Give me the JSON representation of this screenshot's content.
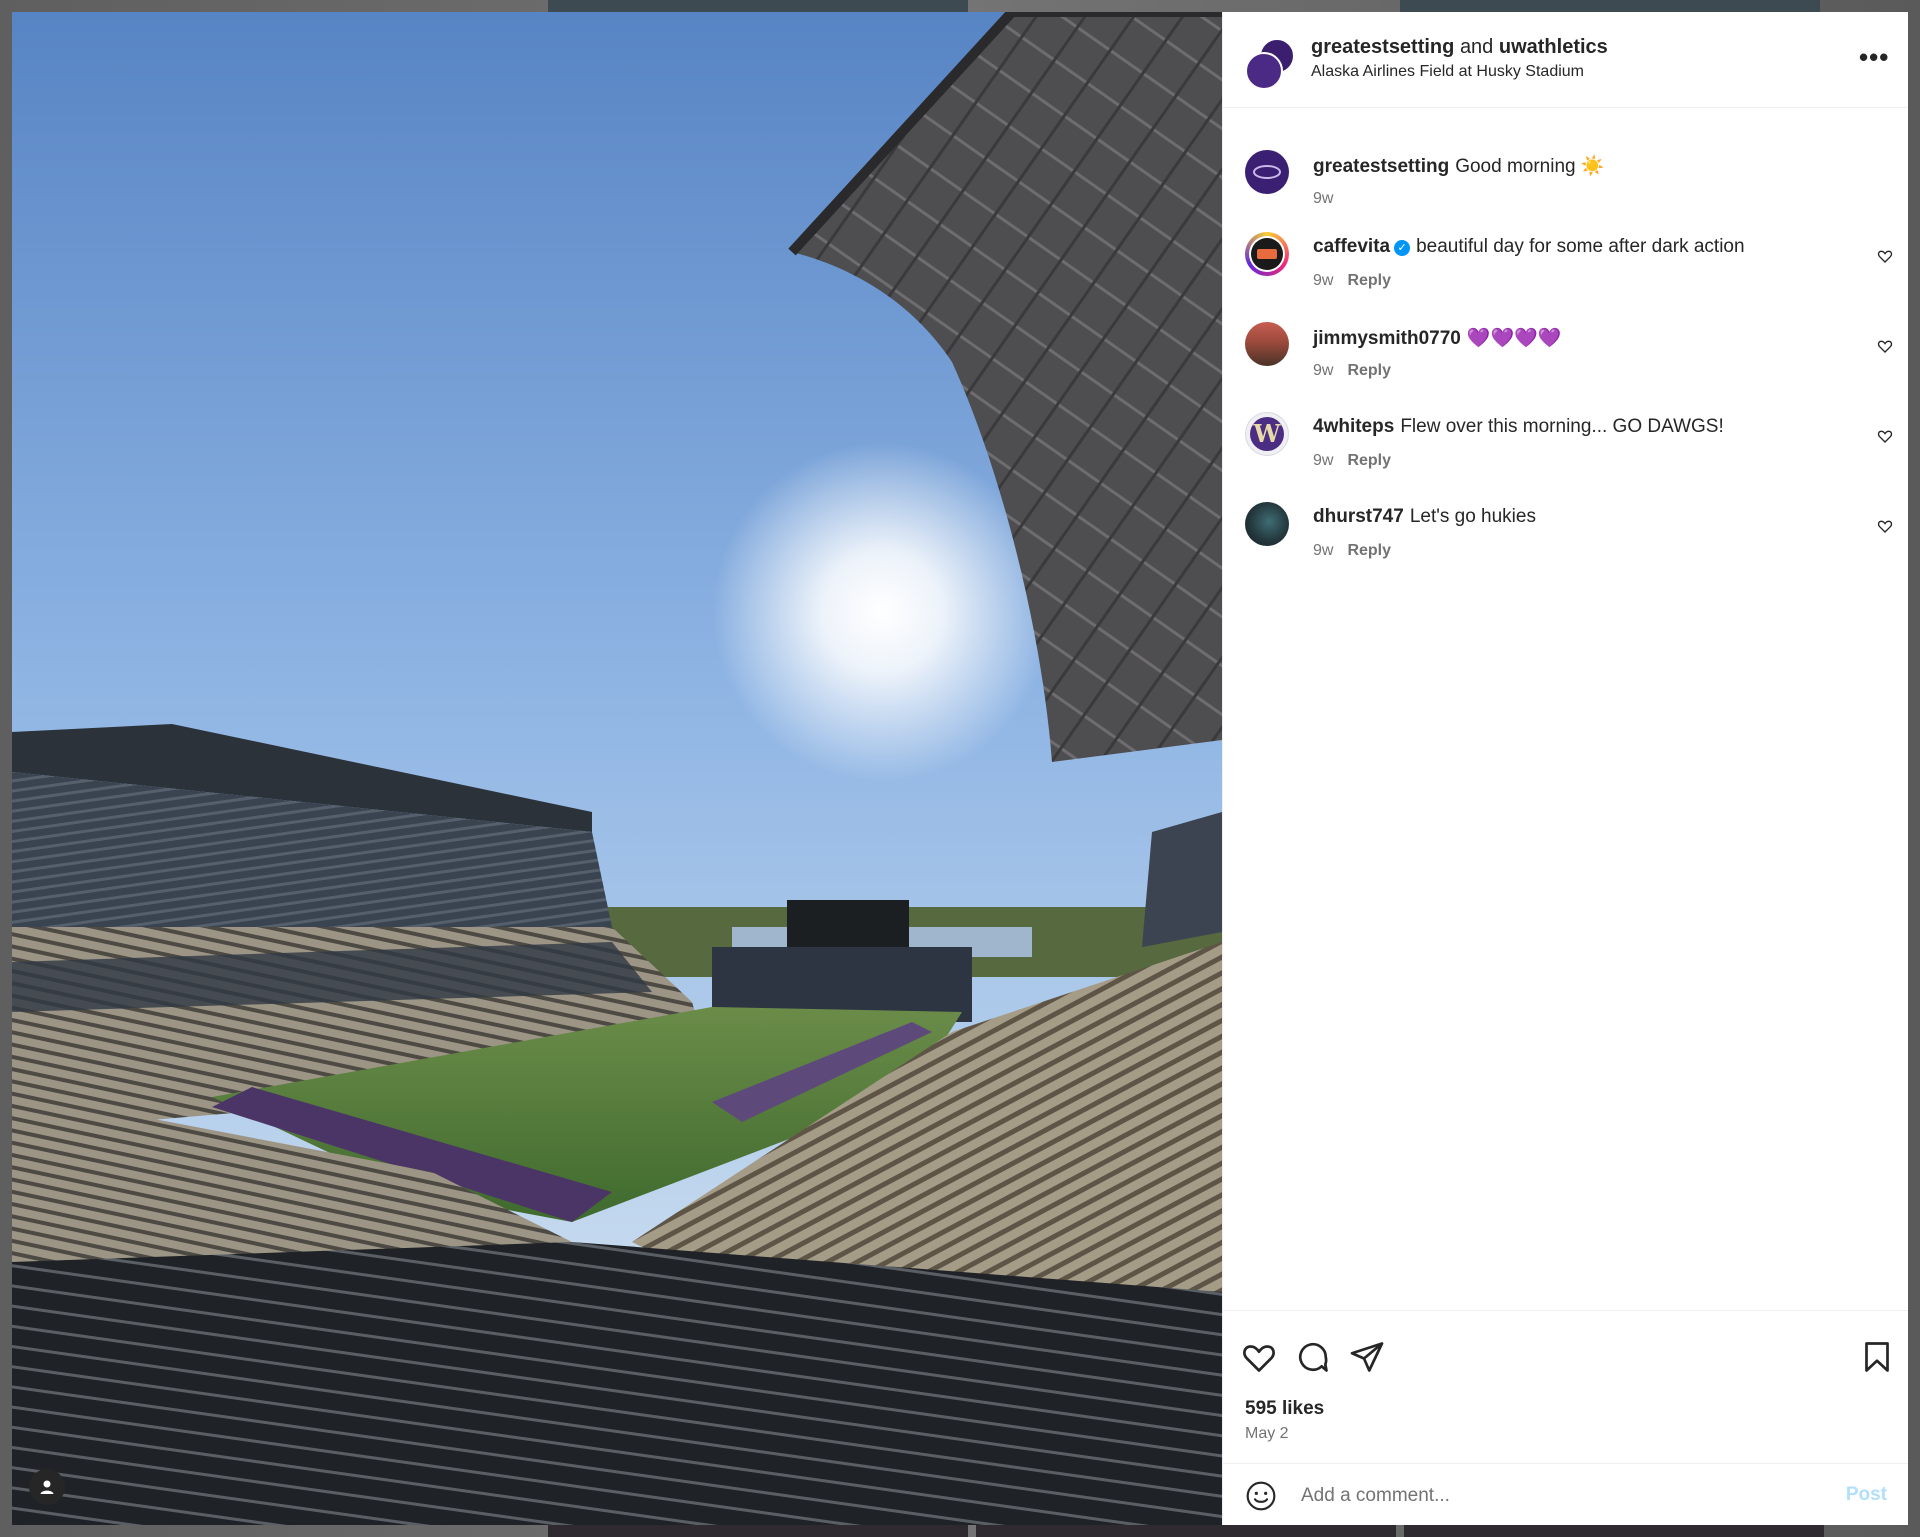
{
  "post": {
    "title_user1": "greatestsetting",
    "title_and": "and",
    "title_user2": "uwathletics",
    "location": "Alaska Airlines Field at Husky Stadium",
    "more_label": "•••"
  },
  "comments": [
    {
      "user": "greatestsetting",
      "text": "Good morning ☀️",
      "time": "9w",
      "reply": "",
      "verified": false
    },
    {
      "user": "caffevita",
      "text": "beautiful day for some after dark action",
      "time": "9w",
      "reply": "Reply",
      "verified": true
    },
    {
      "user": "jimmysmith0770",
      "text": "💜💜💜💜",
      "time": "9w",
      "reply": "Reply",
      "verified": false
    },
    {
      "user": "4whiteps",
      "text": "Flew over this morning... GO DAWGS!",
      "time": "9w",
      "reply": "Reply",
      "verified": false
    },
    {
      "user": "dhurst747",
      "text": "Let's go hukies",
      "time": "9w",
      "reply": "Reply",
      "verified": false
    }
  ],
  "stats": {
    "likes": "595 likes",
    "date": "May 2"
  },
  "composer": {
    "placeholder": "Add a comment...",
    "post_label": "Post"
  },
  "colors": {
    "accent": "#0095f6",
    "post_disabled": "#b2dffc",
    "text": "#262626",
    "secondary": "#737373"
  }
}
